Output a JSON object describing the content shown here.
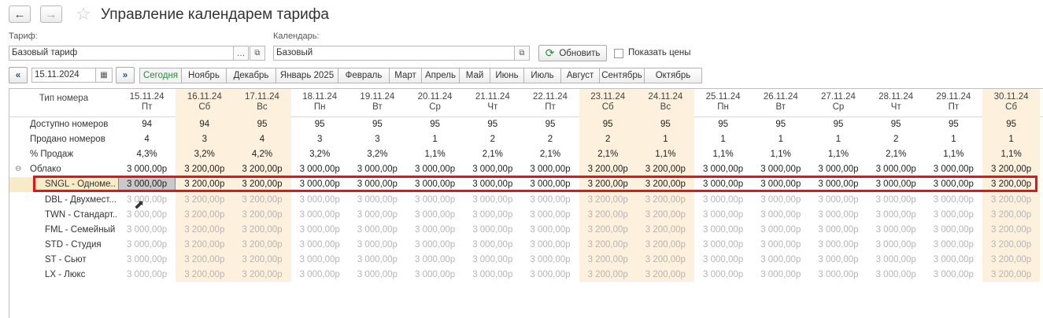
{
  "window": {
    "title": "Управление календарем тарифа"
  },
  "filters": {
    "tariff_label": "Тариф:",
    "tariff_value": "Базовый тариф",
    "calendar_label": "Календарь:",
    "calendar_value": "Базовый",
    "refresh_label": "Обновить",
    "show_prices_label": "Показать цены",
    "date_value": "15.11.2024"
  },
  "tabs": [
    "Сегодня",
    "Ноябрь",
    "Декабрь",
    "Январь 2025",
    "Февраль",
    "Март",
    "Апрель",
    "Май",
    "Июнь",
    "Июль",
    "Август",
    "Сентябрь",
    "Октябрь"
  ],
  "grid": {
    "header_label": "Тип номера",
    "columns": [
      {
        "date": "15.11.24",
        "day": "Пт",
        "weekend": false
      },
      {
        "date": "16.11.24",
        "day": "Сб",
        "weekend": true
      },
      {
        "date": "17.11.24",
        "day": "Вс",
        "weekend": true
      },
      {
        "date": "18.11.24",
        "day": "Пн",
        "weekend": false
      },
      {
        "date": "19.11.24",
        "day": "Вт",
        "weekend": false
      },
      {
        "date": "20.11.24",
        "day": "Ср",
        "weekend": false
      },
      {
        "date": "21.11.24",
        "day": "Чт",
        "weekend": false
      },
      {
        "date": "22.11.24",
        "day": "Пт",
        "weekend": false
      },
      {
        "date": "23.11.24",
        "day": "Сб",
        "weekend": true
      },
      {
        "date": "24.11.24",
        "day": "Вс",
        "weekend": true
      },
      {
        "date": "25.11.24",
        "day": "Пн",
        "weekend": false
      },
      {
        "date": "26.11.24",
        "day": "Вт",
        "weekend": false
      },
      {
        "date": "27.11.24",
        "day": "Ср",
        "weekend": false
      },
      {
        "date": "28.11.24",
        "day": "Чт",
        "weekend": false
      },
      {
        "date": "29.11.24",
        "day": "Пт",
        "weekend": false
      },
      {
        "date": "30.11.24",
        "day": "Сб",
        "weekend": true
      }
    ],
    "rows": [
      {
        "label": "Доступно номеров",
        "style": "stat",
        "values": [
          "94",
          "94",
          "95",
          "95",
          "95",
          "95",
          "95",
          "95",
          "95",
          "95",
          "95",
          "95",
          "95",
          "95",
          "95",
          "95"
        ]
      },
      {
        "label": "Продано номеров",
        "style": "stat",
        "values": [
          "4",
          "3",
          "4",
          "3",
          "3",
          "1",
          "2",
          "2",
          "2",
          "1",
          "1",
          "1",
          "1",
          "2",
          "1",
          "1"
        ]
      },
      {
        "label": "% Продаж",
        "style": "stat",
        "values": [
          "4,3%",
          "3,2%",
          "4,2%",
          "3,2%",
          "3,2%",
          "1,1%",
          "2,1%",
          "2,1%",
          "2,1%",
          "1,1%",
          "1,1%",
          "1,1%",
          "1,1%",
          "2,1%",
          "1,1%",
          "1,1%"
        ]
      },
      {
        "label": "Облако",
        "style": "group",
        "values": [
          "3 000,00р",
          "3 200,00р",
          "3 200,00р",
          "3 000,00р",
          "3 000,00р",
          "3 000,00р",
          "3 000,00р",
          "3 000,00р",
          "3 200,00р",
          "3 200,00р",
          "3 000,00р",
          "3 000,00р",
          "3 000,00р",
          "3 000,00р",
          "3 000,00р",
          "3 200,00р"
        ]
      },
      {
        "label": "SNGL - Одноме...",
        "style": "selected",
        "values": [
          "3 000,00р",
          "3 200,00р",
          "3 200,00р",
          "3 000,00р",
          "3 000,00р",
          "3 000,00р",
          "3 000,00р",
          "3 000,00р",
          "3 200,00р",
          "3 200,00р",
          "3 000,00р",
          "3 000,00р",
          "3 000,00р",
          "3 000,00р",
          "3 000,00р",
          "3 200,00р"
        ]
      },
      {
        "label": "DBL - Двухмест...",
        "style": "dim",
        "values": [
          "3 000,00р",
          "3 200,00р",
          "3 200,00р",
          "3 000,00р",
          "3 000,00р",
          "3 000,00р",
          "3 000,00р",
          "3 000,00р",
          "3 200,00р",
          "3 200,00р",
          "3 000,00р",
          "3 000,00р",
          "3 000,00р",
          "3 000,00р",
          "3 000,00р",
          "3 200,00р"
        ]
      },
      {
        "label": "TWN - Стандарт...",
        "style": "dim",
        "values": [
          "3 000,00р",
          "3 200,00р",
          "3 200,00р",
          "3 000,00р",
          "3 000,00р",
          "3 000,00р",
          "3 000,00р",
          "3 000,00р",
          "3 200,00р",
          "3 200,00р",
          "3 000,00р",
          "3 000,00р",
          "3 000,00р",
          "3 000,00р",
          "3 000,00р",
          "3 200,00р"
        ]
      },
      {
        "label": "FML - Семейный",
        "style": "dim",
        "values": [
          "3 000,00р",
          "3 200,00р",
          "3 200,00р",
          "3 000,00р",
          "3 000,00р",
          "3 000,00р",
          "3 000,00р",
          "3 000,00р",
          "3 200,00р",
          "3 200,00р",
          "3 000,00р",
          "3 000,00р",
          "3 000,00р",
          "3 000,00р",
          "3 000,00р",
          "3 200,00р"
        ]
      },
      {
        "label": "STD - Студия",
        "style": "dim",
        "values": [
          "3 000,00р",
          "3 200,00р",
          "3 200,00р",
          "3 000,00р",
          "3 000,00р",
          "3 000,00р",
          "3 000,00р",
          "3 000,00р",
          "3 200,00р",
          "3 200,00р",
          "3 000,00р",
          "3 000,00р",
          "3 000,00р",
          "3 000,00р",
          "3 000,00р",
          "3 200,00р"
        ]
      },
      {
        "label": "ST - Сьют",
        "style": "dim",
        "values": [
          "3 000,00р",
          "3 200,00р",
          "3 200,00р",
          "3 000,00р",
          "3 000,00р",
          "3 000,00р",
          "3 000,00р",
          "3 000,00р",
          "3 200,00р",
          "3 200,00р",
          "3 000,00р",
          "3 000,00р",
          "3 000,00р",
          "3 000,00р",
          "3 000,00р",
          "3 200,00р"
        ]
      },
      {
        "label": "LX - Люкс",
        "style": "dim",
        "values": [
          "3 000,00р",
          "3 200,00р",
          "3 200,00р",
          "3 000,00р",
          "3 000,00р",
          "3 000,00р",
          "3 000,00р",
          "3 000,00р",
          "3 200,00р",
          "3 200,00р",
          "3 000,00р",
          "3 000,00р",
          "3 000,00р",
          "3 000,00р",
          "3 000,00р",
          "3 200,00р"
        ]
      }
    ]
  },
  "colors": {
    "weekend": "#fdf0dc",
    "accent_green": "#2a8a3a",
    "highlight": "#e0161a"
  }
}
